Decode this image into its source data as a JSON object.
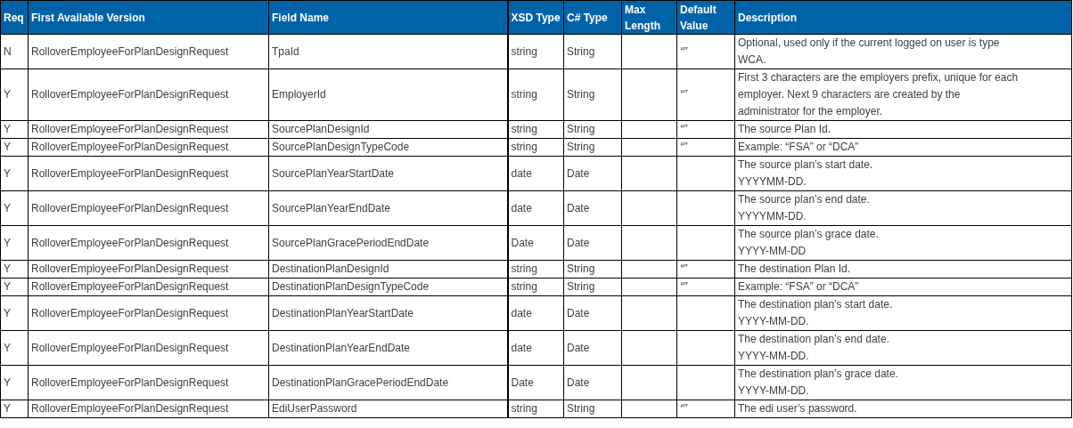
{
  "table": {
    "columns": [
      "Req",
      "First Available Version",
      "Field Name",
      "XSD Type",
      "C# Type",
      "Max Length",
      "Default Value",
      "Description"
    ],
    "rows": [
      {
        "req": "N",
        "version": "RolloverEmployeeForPlanDesignRequest",
        "field": "TpaId",
        "xsd": "string",
        "cs": "String",
        "default": "“”",
        "description": [
          "Optional, used only if the current logged on user is type",
          "WCA."
        ]
      },
      {
        "req": "Y",
        "version": "RolloverEmployeeForPlanDesignRequest",
        "field": "EmployerId",
        "xsd": "string",
        "cs": "String",
        "default": "“”",
        "description": [
          "First 3 characters are the employers prefix, unique for each",
          "employer. Next 9 characters are created by the",
          "administrator for the employer."
        ]
      },
      {
        "req": "Y",
        "version": "RolloverEmployeeForPlanDesignRequest",
        "field": "SourcePlanDesignId",
        "xsd": "string",
        "cs": "String",
        "default": "“”",
        "description": [
          "The source Plan Id."
        ]
      },
      {
        "req": "Y",
        "version": "RolloverEmployeeForPlanDesignRequest",
        "field": "SourcePlanDesignTypeCode",
        "xsd": "string",
        "cs": "String",
        "default": "“”",
        "description": [
          "Example: “FSA” or “DCA”"
        ]
      },
      {
        "req": "Y",
        "version": "RolloverEmployeeForPlanDesignRequest",
        "field": "SourcePlanYearStartDate",
        "xsd": "date",
        "cs": "Date",
        "description": [
          "The source plan’s start date.",
          "YYYYMM-DD."
        ]
      },
      {
        "req": "Y",
        "version": "RolloverEmployeeForPlanDesignRequest",
        "field": "SourcePlanYearEndDate",
        "xsd": "date",
        "cs": "Date",
        "description": [
          "The source plan’s end date.",
          "YYYYMM-DD."
        ]
      },
      {
        "req": "Y",
        "version": "RolloverEmployeeForPlanDesignRequest",
        "field": "SourcePlanGracePeriodEndDate",
        "xsd": "Date",
        "cs": "Date",
        "description": [
          "The source plan’s grace date.",
          "YYYY-MM-DD"
        ]
      },
      {
        "req": "Y",
        "version": "RolloverEmployeeForPlanDesignRequest",
        "field": "DestinationPlanDesignId",
        "xsd": "string",
        "cs": "String",
        "default": "“”",
        "description": [
          "The destination Plan Id."
        ]
      },
      {
        "req": "Y",
        "version": "RolloverEmployeeForPlanDesignRequest",
        "field": "DestinationPlanDesignTypeCode",
        "xsd": "string",
        "cs": "String",
        "default": "“”",
        "description": [
          "Example: “FSA” or “DCA”"
        ]
      },
      {
        "req": "Y",
        "version": "RolloverEmployeeForPlanDesignRequest",
        "field": "DestinationPlanYearStartDate",
        "xsd": "date",
        "cs": "Date",
        "description": [
          "The destination plan’s start date.",
          "YYYY-MM-DD."
        ]
      },
      {
        "req": "Y",
        "version": "RolloverEmployeeForPlanDesignRequest",
        "field": "DestinationPlanYearEndDate",
        "xsd": "date",
        "cs": "Date",
        "description": [
          "The destination plan’s end date.",
          "YYYY-MM-DD."
        ]
      },
      {
        "req": "Y",
        "version": "RolloverEmployeeForPlanDesignRequest",
        "field": "DestinationPlanGracePeriodEndDate",
        "xsd": "Date",
        "cs": "Date",
        "description": [
          "The destination plan’s grace date.",
          "YYYY-MM-DD."
        ]
      },
      {
        "req": "Y",
        "version": "RolloverEmployeeForPlanDesignRequest",
        "field": "EdiUserPassword",
        "xsd": "string",
        "cs": "String",
        "default": "“”",
        "description": [
          "The edi user’s password."
        ]
      }
    ]
  }
}
